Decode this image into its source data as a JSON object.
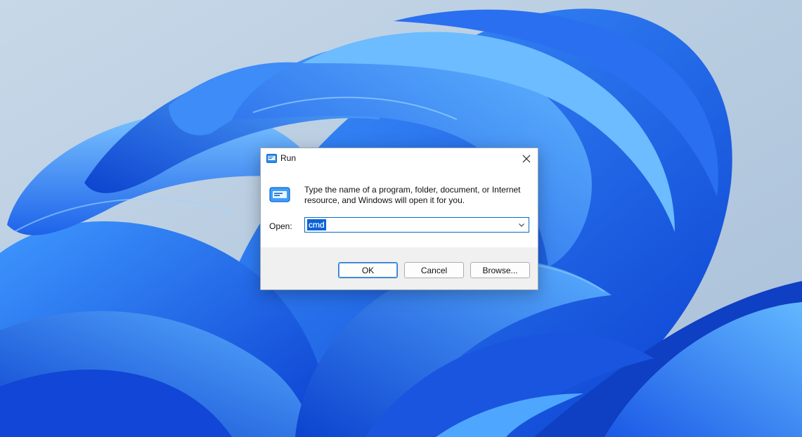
{
  "desktop": {
    "background_color": "#b9cde2",
    "wallpaper_name": "Windows 11 Bloom",
    "accent": "#1a5ff0"
  },
  "run_dialog": {
    "title": "Run",
    "title_icon": "run-icon",
    "close_icon": "close-icon",
    "description": "Type the name of a program, folder, document, or Internet resource, and Windows will open it for you.",
    "open_label": "Open:",
    "open_value": "cmd",
    "dropdown_icon": "chevron-down-icon",
    "buttons": {
      "ok": "OK",
      "cancel": "Cancel",
      "browse": "Browse..."
    }
  }
}
